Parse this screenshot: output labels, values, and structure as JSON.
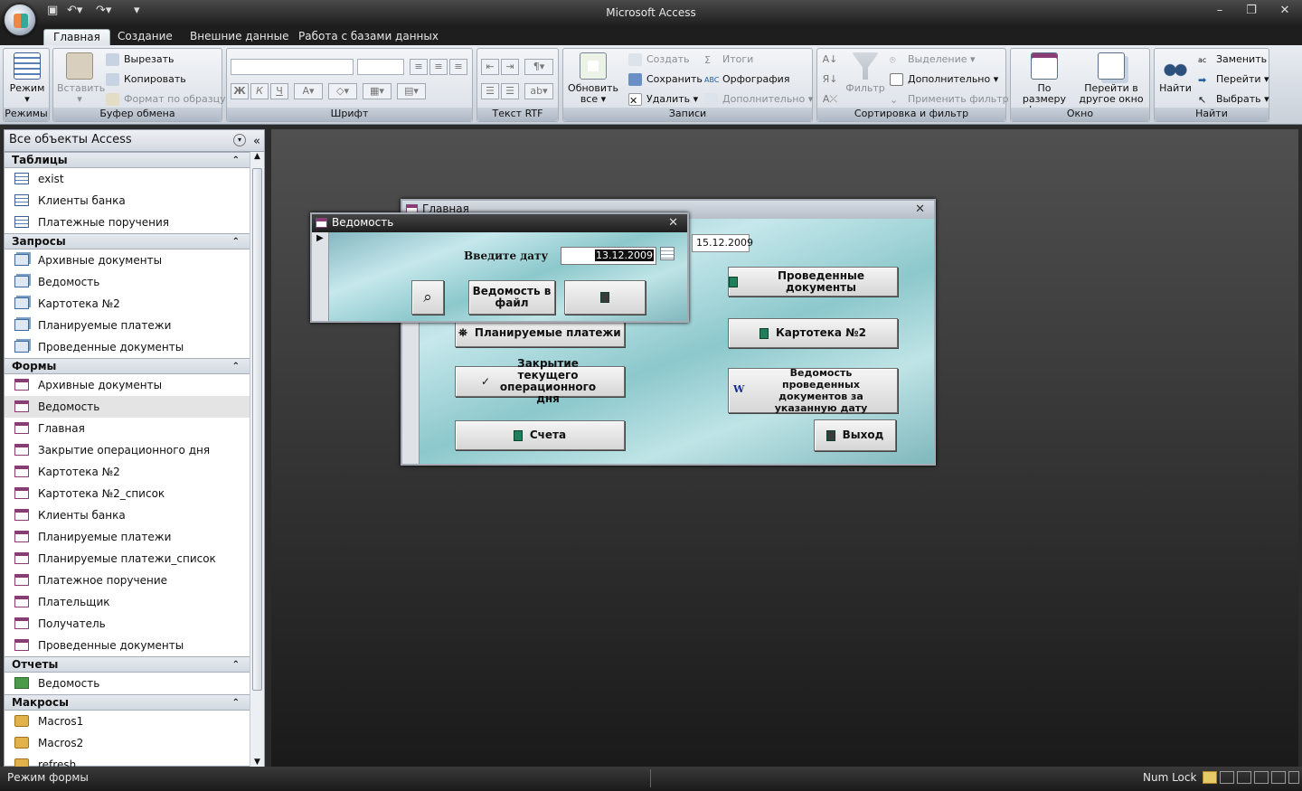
{
  "window": {
    "title": "Microsoft Access"
  },
  "tabs": [
    "Главная",
    "Создание",
    "Внешние данные",
    "Работа с базами данных"
  ],
  "ribbon": {
    "modes": {
      "view": "Режим",
      "label": "Режимы"
    },
    "clipboard": {
      "paste": "Вставить",
      "cut": "Вырезать",
      "copy": "Копировать",
      "format_painter": "Формат по образцу",
      "label": "Буфер обмена"
    },
    "font": {
      "bold": "Ж",
      "italic": "К",
      "underline": "Ч",
      "label": "Шрифт"
    },
    "rtf": {
      "label": "Текст RTF"
    },
    "records": {
      "refresh": "Обновить",
      "refresh2": "все",
      "new": "Создать",
      "save": "Сохранить",
      "delete": "Удалить",
      "totals": "Итоги",
      "spelling": "Орфография",
      "more": "Дополнительно",
      "label": "Записи"
    },
    "sort": {
      "filter": "Фильтр",
      "selection": "Выделение",
      "advanced": "Дополнительно",
      "toggle": "Применить фильтр",
      "label": "Сортировка и фильтр"
    },
    "window": {
      "fit1": "По размеру",
      "fit2": "формы",
      "switch1": "Перейти в",
      "switch2": "другое окно",
      "label": "Окно"
    },
    "find": {
      "find": "Найти",
      "replace": "Заменить",
      "goto": "Перейти",
      "select": "Выбрать",
      "label": "Найти"
    }
  },
  "nav": {
    "header": "Все объекты Access",
    "sections": [
      {
        "name": "Таблицы",
        "items": [
          "exist",
          "Клиенты банка",
          "Платежные поручения"
        ]
      },
      {
        "name": "Запросы",
        "items": [
          "Архивные документы",
          "Ведомость",
          "Картотека №2",
          "Планируемые платежи",
          "Проведенные документы"
        ]
      },
      {
        "name": "Формы",
        "items": [
          "Архивные документы",
          "Ведомость",
          "Главная",
          "Закрытие операционного дня",
          "Картотека №2",
          "Картотека №2_список",
          "Клиенты банка",
          "Планируемые платежи",
          "Планируемые платежи_список",
          "Платежное поручение",
          "Плательщик",
          "Получатель",
          "Проведенные документы"
        ]
      },
      {
        "name": "Отчеты",
        "items": [
          "Ведомость"
        ]
      },
      {
        "name": "Макросы",
        "items": [
          "Macros1",
          "Macros2",
          "refresh"
        ]
      }
    ]
  },
  "main_form": {
    "title": "Главная",
    "date": "15.12.2009",
    "buttons": {
      "planned": "Планируемые платежи",
      "closing": "Закрытие текущего операционного дня",
      "accounts": "Счета",
      "processed": "Проведенные документы",
      "card2": "Картотека №2",
      "statement": "Ведомость проведенных документов за указанную дату",
      "exit": "Выход"
    }
  },
  "vedomost_form": {
    "title": "Ведомость",
    "date_label": "Введите дату",
    "date_value": "13.12.2009",
    "file_button": "Ведомость в файл"
  },
  "status": {
    "left": "Режим формы",
    "numlock": "Num Lock"
  }
}
